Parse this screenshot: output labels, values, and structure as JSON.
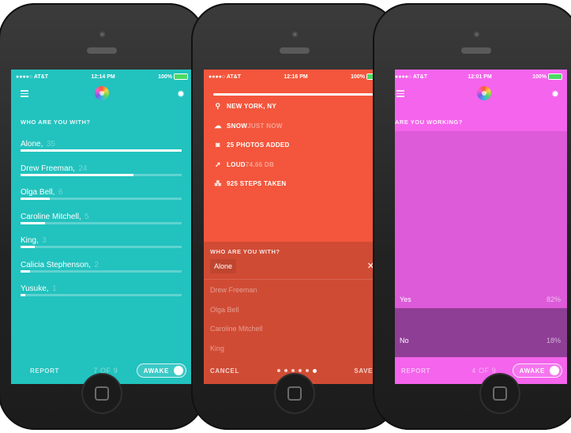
{
  "colors": {
    "teal": "#22c2be",
    "coral": "#f3563c",
    "magenta": "#f464ec"
  },
  "phone1": {
    "status": {
      "carrier": "●●●●○ AT&T",
      "time": "12:14 PM",
      "battery": "100%"
    },
    "question": "WHO ARE YOU WITH?",
    "people": [
      {
        "name": "Alone,",
        "count": "35",
        "level": 1.0
      },
      {
        "name": "Drew Freeman,",
        "count": "24",
        "level": 0.7
      },
      {
        "name": "Olga Bell,",
        "count": "6",
        "level": 0.18
      },
      {
        "name": "Caroline Mitchell,",
        "count": "5",
        "level": 0.15
      },
      {
        "name": "King,",
        "count": "3",
        "level": 0.09
      },
      {
        "name": "Calicia Stephenson,",
        "count": "2",
        "level": 0.06
      },
      {
        "name": "Yusuke,",
        "count": "1",
        "level": 0.03
      }
    ],
    "report": "REPORT",
    "page": "7 OF 9",
    "toggle": "AWAKE"
  },
  "phone2": {
    "status": {
      "carrier": "●●●●○ AT&T",
      "time": "12:16 PM",
      "battery": "100%"
    },
    "feed": [
      {
        "icon": "location-pin-icon",
        "glyph": "⚲",
        "text": "NEW YORK, NY",
        "dim": ""
      },
      {
        "icon": "cloud-icon",
        "glyph": "☁",
        "text": "SNOW",
        "dim": "JUST NOW"
      },
      {
        "icon": "camera-icon",
        "glyph": "◙",
        "text": "25 PHOTOS ADDED",
        "dim": ""
      },
      {
        "icon": "megaphone-icon",
        "glyph": "➚",
        "text": "LOUD",
        "dim": "74.66 DB"
      },
      {
        "icon": "footsteps-icon",
        "glyph": "⁂",
        "text": "925 STEPS TAKEN",
        "dim": ""
      }
    ],
    "question": "WHO ARE YOU WITH?",
    "selected": "Alone",
    "suggestions": [
      "Drew Freeman",
      "Olga Bell",
      "Caroline Mitchell",
      "King"
    ],
    "cancel": "CANCEL",
    "save": "SAVE",
    "dots_total": 6,
    "dots_active": 6
  },
  "phone3": {
    "status": {
      "carrier": "●●●●○ AT&T",
      "time": "12:01 PM",
      "battery": "100%"
    },
    "question": "ARE YOU WORKING?",
    "options": [
      {
        "label": "Yes",
        "pct": "82%"
      },
      {
        "label": "No",
        "pct": "18%"
      }
    ],
    "report": "REPORT",
    "page": "4 OF 9",
    "toggle": "AWAKE"
  }
}
